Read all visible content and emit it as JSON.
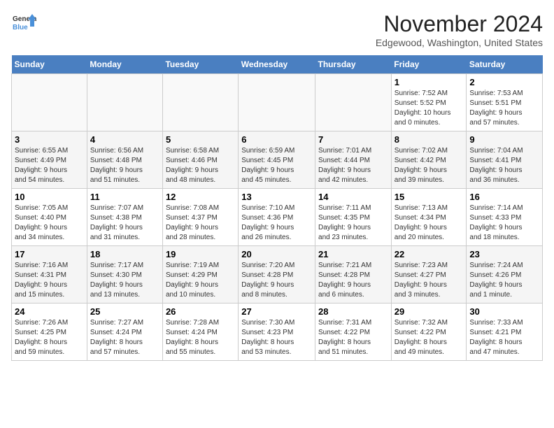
{
  "header": {
    "logo_line1": "General",
    "logo_line2": "Blue",
    "month": "November 2024",
    "location": "Edgewood, Washington, United States"
  },
  "weekdays": [
    "Sunday",
    "Monday",
    "Tuesday",
    "Wednesday",
    "Thursday",
    "Friday",
    "Saturday"
  ],
  "weeks": [
    [
      {
        "day": "",
        "info": ""
      },
      {
        "day": "",
        "info": ""
      },
      {
        "day": "",
        "info": ""
      },
      {
        "day": "",
        "info": ""
      },
      {
        "day": "",
        "info": ""
      },
      {
        "day": "1",
        "info": "Sunrise: 7:52 AM\nSunset: 5:52 PM\nDaylight: 10 hours\nand 0 minutes."
      },
      {
        "day": "2",
        "info": "Sunrise: 7:53 AM\nSunset: 5:51 PM\nDaylight: 9 hours\nand 57 minutes."
      }
    ],
    [
      {
        "day": "3",
        "info": "Sunrise: 6:55 AM\nSunset: 4:49 PM\nDaylight: 9 hours\nand 54 minutes."
      },
      {
        "day": "4",
        "info": "Sunrise: 6:56 AM\nSunset: 4:48 PM\nDaylight: 9 hours\nand 51 minutes."
      },
      {
        "day": "5",
        "info": "Sunrise: 6:58 AM\nSunset: 4:46 PM\nDaylight: 9 hours\nand 48 minutes."
      },
      {
        "day": "6",
        "info": "Sunrise: 6:59 AM\nSunset: 4:45 PM\nDaylight: 9 hours\nand 45 minutes."
      },
      {
        "day": "7",
        "info": "Sunrise: 7:01 AM\nSunset: 4:44 PM\nDaylight: 9 hours\nand 42 minutes."
      },
      {
        "day": "8",
        "info": "Sunrise: 7:02 AM\nSunset: 4:42 PM\nDaylight: 9 hours\nand 39 minutes."
      },
      {
        "day": "9",
        "info": "Sunrise: 7:04 AM\nSunset: 4:41 PM\nDaylight: 9 hours\nand 36 minutes."
      }
    ],
    [
      {
        "day": "10",
        "info": "Sunrise: 7:05 AM\nSunset: 4:40 PM\nDaylight: 9 hours\nand 34 minutes."
      },
      {
        "day": "11",
        "info": "Sunrise: 7:07 AM\nSunset: 4:38 PM\nDaylight: 9 hours\nand 31 minutes."
      },
      {
        "day": "12",
        "info": "Sunrise: 7:08 AM\nSunset: 4:37 PM\nDaylight: 9 hours\nand 28 minutes."
      },
      {
        "day": "13",
        "info": "Sunrise: 7:10 AM\nSunset: 4:36 PM\nDaylight: 9 hours\nand 26 minutes."
      },
      {
        "day": "14",
        "info": "Sunrise: 7:11 AM\nSunset: 4:35 PM\nDaylight: 9 hours\nand 23 minutes."
      },
      {
        "day": "15",
        "info": "Sunrise: 7:13 AM\nSunset: 4:34 PM\nDaylight: 9 hours\nand 20 minutes."
      },
      {
        "day": "16",
        "info": "Sunrise: 7:14 AM\nSunset: 4:33 PM\nDaylight: 9 hours\nand 18 minutes."
      }
    ],
    [
      {
        "day": "17",
        "info": "Sunrise: 7:16 AM\nSunset: 4:31 PM\nDaylight: 9 hours\nand 15 minutes."
      },
      {
        "day": "18",
        "info": "Sunrise: 7:17 AM\nSunset: 4:30 PM\nDaylight: 9 hours\nand 13 minutes."
      },
      {
        "day": "19",
        "info": "Sunrise: 7:19 AM\nSunset: 4:29 PM\nDaylight: 9 hours\nand 10 minutes."
      },
      {
        "day": "20",
        "info": "Sunrise: 7:20 AM\nSunset: 4:28 PM\nDaylight: 9 hours\nand 8 minutes."
      },
      {
        "day": "21",
        "info": "Sunrise: 7:21 AM\nSunset: 4:28 PM\nDaylight: 9 hours\nand 6 minutes."
      },
      {
        "day": "22",
        "info": "Sunrise: 7:23 AM\nSunset: 4:27 PM\nDaylight: 9 hours\nand 3 minutes."
      },
      {
        "day": "23",
        "info": "Sunrise: 7:24 AM\nSunset: 4:26 PM\nDaylight: 9 hours\nand 1 minute."
      }
    ],
    [
      {
        "day": "24",
        "info": "Sunrise: 7:26 AM\nSunset: 4:25 PM\nDaylight: 8 hours\nand 59 minutes."
      },
      {
        "day": "25",
        "info": "Sunrise: 7:27 AM\nSunset: 4:24 PM\nDaylight: 8 hours\nand 57 minutes."
      },
      {
        "day": "26",
        "info": "Sunrise: 7:28 AM\nSunset: 4:24 PM\nDaylight: 8 hours\nand 55 minutes."
      },
      {
        "day": "27",
        "info": "Sunrise: 7:30 AM\nSunset: 4:23 PM\nDaylight: 8 hours\nand 53 minutes."
      },
      {
        "day": "28",
        "info": "Sunrise: 7:31 AM\nSunset: 4:22 PM\nDaylight: 8 hours\nand 51 minutes."
      },
      {
        "day": "29",
        "info": "Sunrise: 7:32 AM\nSunset: 4:22 PM\nDaylight: 8 hours\nand 49 minutes."
      },
      {
        "day": "30",
        "info": "Sunrise: 7:33 AM\nSunset: 4:21 PM\nDaylight: 8 hours\nand 47 minutes."
      }
    ]
  ]
}
